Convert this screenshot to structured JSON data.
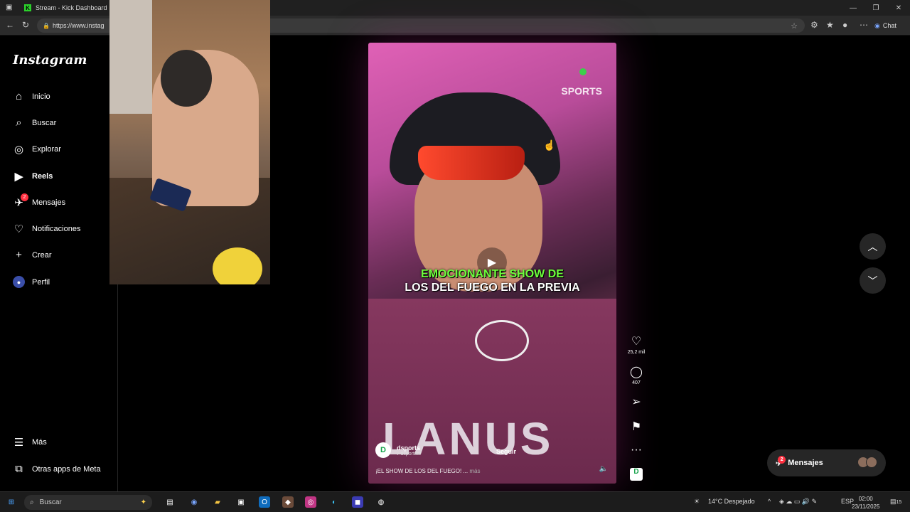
{
  "browser": {
    "tab_title": "Stream - Kick Dashboard",
    "url": "https://www.instag",
    "chat_label": "Chat"
  },
  "sidebar": {
    "logo": "Instagram",
    "items": [
      {
        "label": "Inicio",
        "icon": "home-icon"
      },
      {
        "label": "Buscar",
        "icon": "search-icon"
      },
      {
        "label": "Explorar",
        "icon": "compass-icon"
      },
      {
        "label": "Reels",
        "icon": "reels-icon"
      },
      {
        "label": "Mensajes",
        "icon": "messenger-icon",
        "badge": "2"
      },
      {
        "label": "Notificaciones",
        "icon": "heart-icon"
      },
      {
        "label": "Crear",
        "icon": "plus-icon"
      },
      {
        "label": "Perfil",
        "icon": "avatar-icon"
      }
    ],
    "bottom": [
      {
        "label": "Más",
        "icon": "menu-icon"
      },
      {
        "label": "Otras apps de Meta",
        "icon": "meta-apps-icon"
      }
    ]
  },
  "reel": {
    "watermark": "SPORTS",
    "caption_line1": "EMOCIONANTE SHOW DE",
    "caption_line2": "LOS DEL FUEGO EN LA PREVIA",
    "jersey_text": "LANUS",
    "author_name": "dsports",
    "author_handle": "dsportsar",
    "follow_label": "Seguir",
    "description": "¡EL SHOW DE LOS DEL FUEGO! ...",
    "more_label": "más"
  },
  "actions": {
    "likes": "25,2 mil",
    "comments": "407"
  },
  "messages": {
    "label": "Mensajes",
    "badge": "2"
  },
  "taskbar": {
    "search_placeholder": "Buscar",
    "weather": "14°C  Despejado",
    "language": "ESP",
    "time": "02:00",
    "date": "23/11/2025",
    "notif_count": "15"
  }
}
